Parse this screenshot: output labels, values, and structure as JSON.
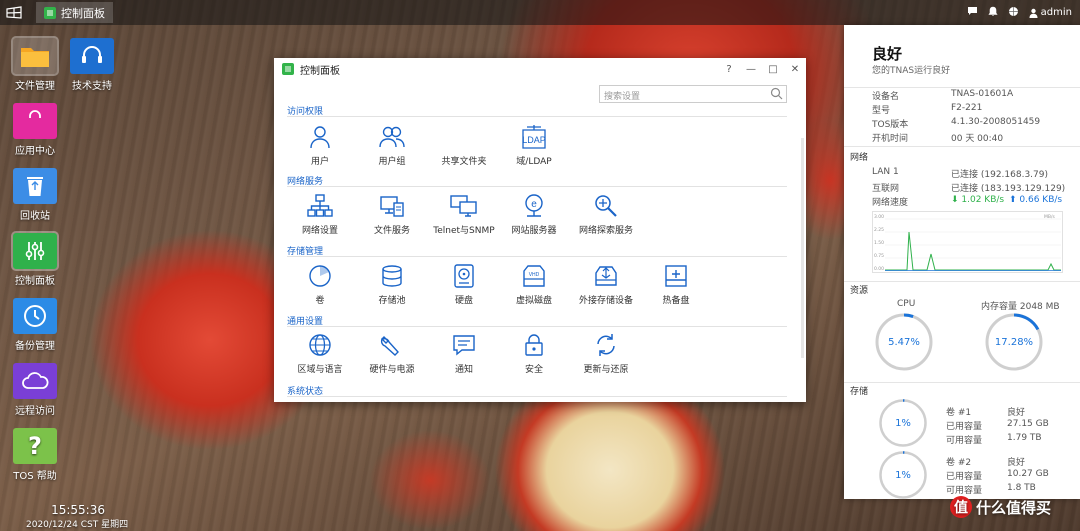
{
  "taskbar": {
    "active_tab": "控制面板",
    "user": "admin",
    "icons": [
      "chat-icon",
      "bell-icon",
      "globe-icon",
      "user-icon"
    ]
  },
  "desktop": {
    "icons": [
      {
        "name": "files",
        "label": "文件管理",
        "color": "#f5a623"
      },
      {
        "name": "support",
        "label": "技术支持",
        "color": "#1e6fd0"
      },
      {
        "name": "appcenter",
        "label": "应用中心",
        "color": "#e42a9f"
      },
      {
        "name": "recycle",
        "label": "回收站",
        "color": "#3c8de6"
      },
      {
        "name": "controlpanel",
        "label": "控制面板",
        "color": "#2fb14b"
      },
      {
        "name": "backup",
        "label": "备份管理",
        "color": "#2c8be6"
      },
      {
        "name": "remote",
        "label": "远程访问",
        "color": "#7a3fd6"
      },
      {
        "name": "help",
        "label": "TOS 帮助",
        "color": "#7cc24a"
      }
    ],
    "clock": {
      "time": "15:55:36",
      "date": "2020/12/24 CST 星期四"
    }
  },
  "window": {
    "title": "控制面板",
    "controls": [
      "?",
      "—",
      "□",
      "✕"
    ],
    "search_placeholder": "搜索设置",
    "sections": [
      {
        "title": "访问权限",
        "items": [
          {
            "label": "用户",
            "icon": "user-icon"
          },
          {
            "label": "用户组",
            "icon": "group-icon"
          },
          {
            "label": "共享文件夹",
            "icon": "folder-icon"
          },
          {
            "label": "域/LDAP",
            "icon": "ldap-icon"
          }
        ]
      },
      {
        "title": "网络服务",
        "items": [
          {
            "label": "网络设置",
            "icon": "network-icon"
          },
          {
            "label": "文件服务",
            "icon": "file-service-icon"
          },
          {
            "label": "Telnet与SNMP",
            "icon": "monitor-icon"
          },
          {
            "label": "网站服务器",
            "icon": "web-server-icon"
          },
          {
            "label": "网络探索服务",
            "icon": "discovery-icon"
          }
        ]
      },
      {
        "title": "存储管理",
        "items": [
          {
            "label": "卷",
            "icon": "volume-icon"
          },
          {
            "label": "存储池",
            "icon": "storage-pool-icon"
          },
          {
            "label": "硬盘",
            "icon": "disk-icon"
          },
          {
            "label": "虚拟磁盘",
            "icon": "virtual-disk-icon"
          },
          {
            "label": "外接存储设备",
            "icon": "usb-storage-icon"
          },
          {
            "label": "热备盘",
            "icon": "hot-spare-icon"
          }
        ]
      },
      {
        "title": "通用设置",
        "items": [
          {
            "label": "区域与语言",
            "icon": "globe-icon"
          },
          {
            "label": "硬件与电源",
            "icon": "wrench-icon"
          },
          {
            "label": "通知",
            "icon": "message-icon"
          },
          {
            "label": "安全",
            "icon": "lock-icon"
          },
          {
            "label": "更新与还原",
            "icon": "refresh-icon"
          }
        ]
      },
      {
        "title": "系统状态",
        "items": []
      }
    ]
  },
  "status_panel": {
    "status": "良好",
    "subtitle": "您的TNAS运行良好",
    "device": {
      "rows": [
        {
          "key": "设备名",
          "value": "TNAS-01601A"
        },
        {
          "key": "型号",
          "value": "F2-221"
        },
        {
          "key": "TOS版本",
          "value": "4.1.30-2008051459"
        },
        {
          "key": "开机时间",
          "value": "00 天 00:40"
        }
      ]
    },
    "network": {
      "section": "网络",
      "rows": [
        {
          "key": "LAN 1",
          "value": "已连接 (192.168.3.79)"
        },
        {
          "key": "互联网",
          "value": "已连接 (183.193.129.129)"
        }
      ],
      "speed_label": "网络速度",
      "down": "1.02 KB/s",
      "up": "0.66 KB/s",
      "down_color": "#2fb14b",
      "up_color": "#1a73d9",
      "chart_unit": "MB/s",
      "chart_ticks": [
        "3.00",
        "2.25",
        "1.50",
        "0.75",
        "0.00"
      ]
    },
    "resources": {
      "section": "资源",
      "cpu_label": "CPU",
      "cpu_value": "5.47%",
      "cpu_fraction": 0.0547,
      "mem_label": "内存容量 2048 MB",
      "mem_value": "17.28%",
      "mem_fraction": 0.1728
    },
    "storage": {
      "section": "存储",
      "volumes": [
        {
          "percent": "1%",
          "fraction": 0.01,
          "name": "卷 #1",
          "status": "良好",
          "used_label": "已用容量",
          "used": "27.15 GB",
          "avail_label": "可用容量",
          "avail": "1.79 TB"
        },
        {
          "percent": "1%",
          "fraction": 0.01,
          "name": "卷 #2",
          "status": "良好",
          "used_label": "已用容量",
          "used": "10.27 GB",
          "avail_label": "可用容量",
          "avail": "1.8 TB"
        }
      ]
    }
  },
  "watermark": {
    "badge": "值",
    "text": "什么值得买"
  }
}
